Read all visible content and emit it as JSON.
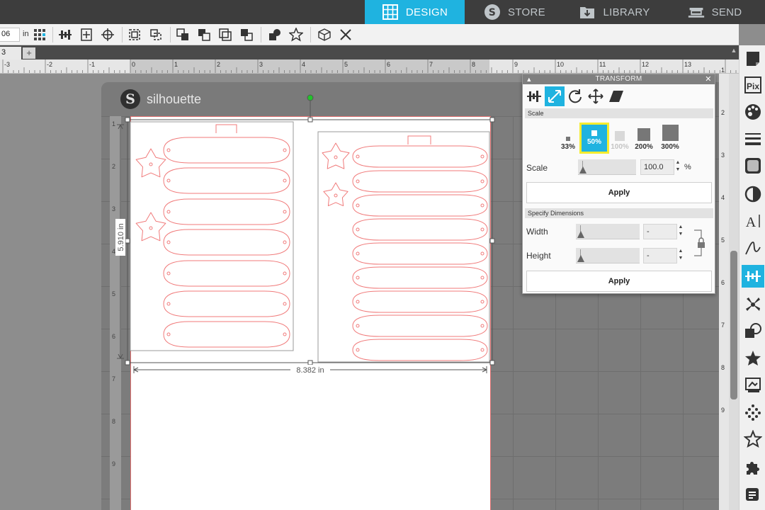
{
  "nav": {
    "tabs": [
      {
        "label": "DESIGN",
        "icon": "grid-icon",
        "active": true
      },
      {
        "label": "STORE",
        "icon": "silhouette-s-icon",
        "active": false
      },
      {
        "label": "LIBRARY",
        "icon": "library-download-icon",
        "active": false
      },
      {
        "label": "SEND",
        "icon": "cutter-machine-icon",
        "active": false
      }
    ],
    "accent_color": "#1fb3e0"
  },
  "toolbar": {
    "unit_value": "06",
    "unit_label": "in"
  },
  "tabstrip": {
    "doc_tab": "3",
    "add_label": "+"
  },
  "rulers": {
    "horizontal": [
      "-3",
      "-2",
      "-1",
      "0",
      "1",
      "2",
      "3",
      "4",
      "5",
      "6",
      "7",
      "8",
      "9",
      "10",
      "11",
      "12",
      "13"
    ],
    "right": [
      "1",
      "2",
      "3",
      "4",
      "5",
      "6",
      "7",
      "8",
      "9"
    ],
    "mat": [
      "1",
      "2",
      "3",
      "4",
      "5",
      "6",
      "7",
      "8",
      "9"
    ]
  },
  "mat": {
    "brand": "silhouette",
    "logo_letter": "S"
  },
  "selection": {
    "width_label": "8.382 in",
    "height_label": "5.910 in",
    "cut_line_color": "#f07a7a"
  },
  "transform": {
    "title": "TRANSFORM",
    "scale_section": "Scale",
    "scale_options": [
      {
        "label": "33%",
        "state": "normal"
      },
      {
        "label": "50%",
        "state": "highlighted"
      },
      {
        "label": "100%",
        "state": "disabled"
      },
      {
        "label": "200%",
        "state": "normal"
      },
      {
        "label": "300%",
        "state": "normal"
      }
    ],
    "scale_label": "Scale",
    "scale_value": "100.0",
    "scale_unit": "%",
    "apply_label": "Apply",
    "dimensions_section": "Specify Dimensions",
    "width_label": "Width",
    "width_value": "-",
    "height_label": "Height",
    "height_value": "-",
    "apply2_label": "Apply",
    "highlight_color": "#f5ec2e"
  }
}
